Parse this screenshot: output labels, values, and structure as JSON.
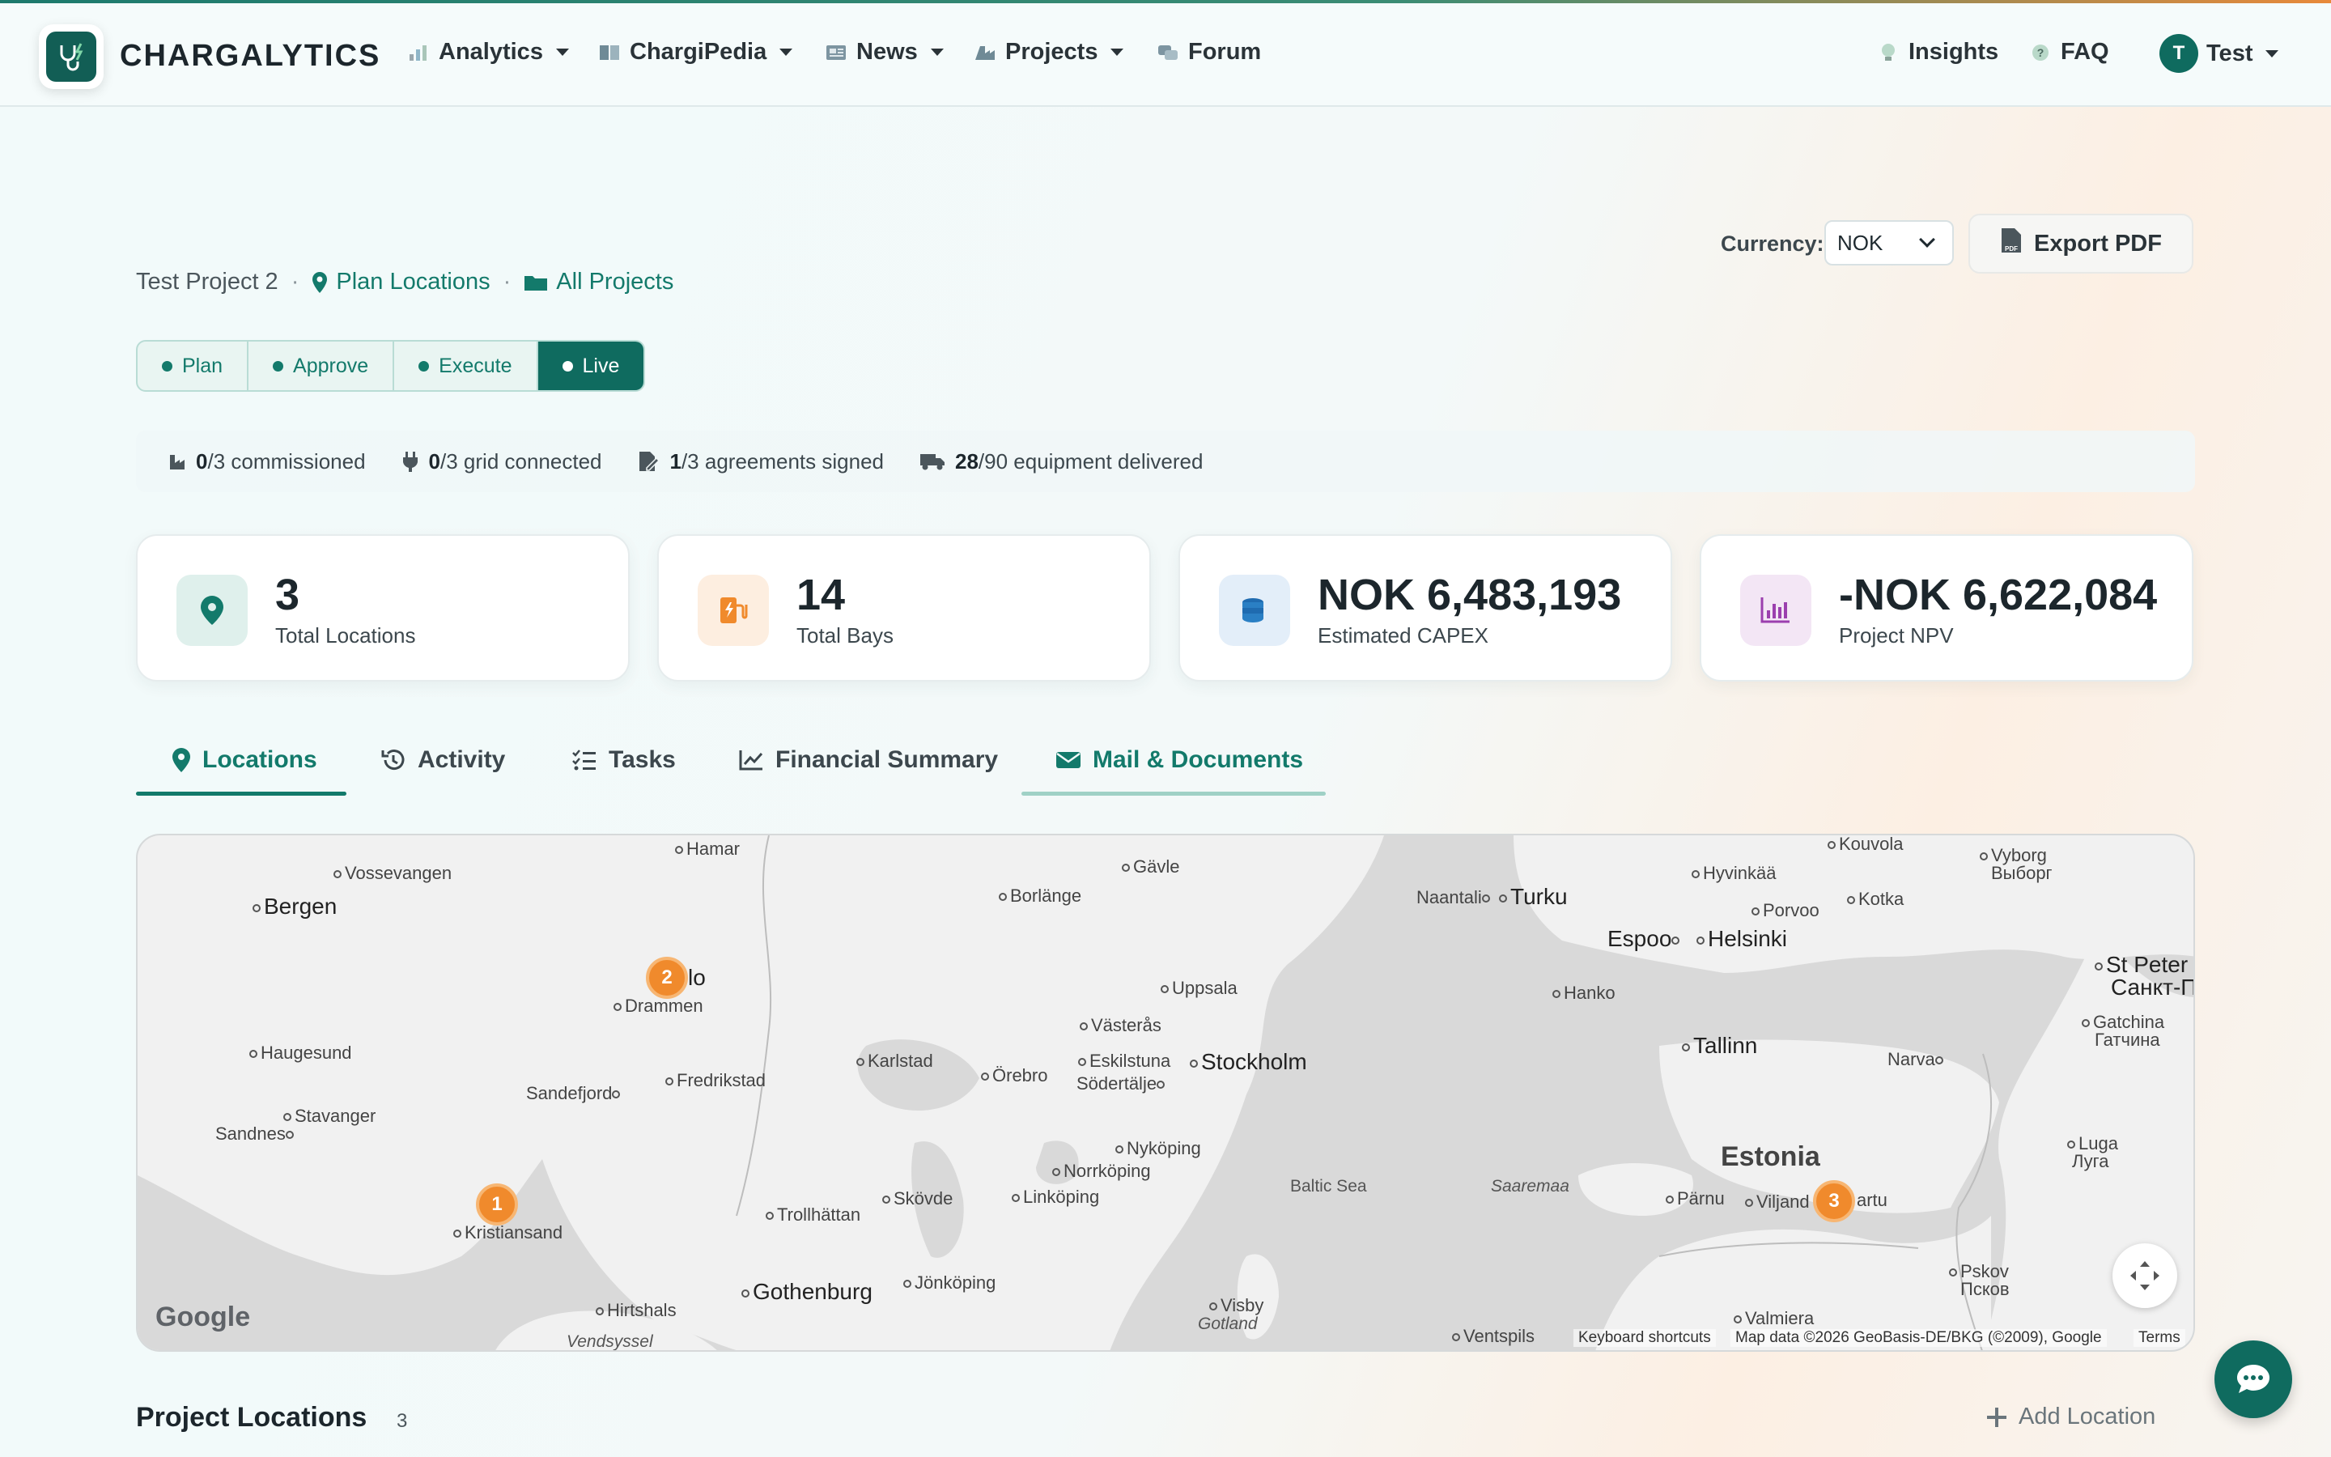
{
  "nav": {
    "brand": "CHARGALYTICS",
    "items": [
      {
        "label": "Analytics",
        "icon": "analytics-icon"
      },
      {
        "label": "ChargiPedia",
        "icon": "book-icon"
      },
      {
        "label": "News",
        "icon": "newspaper-icon"
      },
      {
        "label": "Projects",
        "icon": "projects-icon"
      },
      {
        "label": "Forum",
        "icon": "forum-icon"
      }
    ],
    "insights": "Insights",
    "faq": "FAQ",
    "user_initial": "T",
    "user_name": "Test"
  },
  "header": {
    "currency_label": "Currency:",
    "currency_value": "NOK",
    "export_label": "Export PDF"
  },
  "breadcrumb": {
    "project": "Test Project 2",
    "plan_locations": "Plan Locations",
    "all_projects": "All Projects"
  },
  "stages": [
    {
      "label": "Plan",
      "active": false
    },
    {
      "label": "Approve",
      "active": false
    },
    {
      "label": "Execute",
      "active": false
    },
    {
      "label": "Live",
      "active": true
    }
  ],
  "progress": [
    {
      "done": "0",
      "rest": "/3 commissioned",
      "icon": "factory-icon"
    },
    {
      "done": "0",
      "rest": "/3 grid connected",
      "icon": "plug-icon"
    },
    {
      "done": "1",
      "rest": "/3 agreements signed",
      "icon": "signature-icon"
    },
    {
      "done": "28",
      "rest": "/90 equipment delivered",
      "icon": "truck-icon"
    }
  ],
  "stats": [
    {
      "value": "3",
      "label": "Total Locations",
      "icon": "location-pin-icon"
    },
    {
      "value": "14",
      "label": "Total Bays",
      "icon": "charging-station-icon"
    },
    {
      "value": "NOK 6,483,193",
      "label": "Estimated CAPEX",
      "icon": "coins-icon"
    },
    {
      "value": "-NOK 6,622,084",
      "label": "Project NPV",
      "icon": "bar-chart-icon"
    }
  ],
  "tabs": [
    {
      "label": "Locations",
      "icon": "location-pin-icon"
    },
    {
      "label": "Activity",
      "icon": "history-icon"
    },
    {
      "label": "Tasks",
      "icon": "checklist-icon"
    },
    {
      "label": "Financial Summary",
      "icon": "line-chart-icon"
    },
    {
      "label": "Mail & Documents",
      "icon": "envelope-icon"
    }
  ],
  "map": {
    "labels": {
      "bergen": "Bergen",
      "vossevangen": "Vossevangen",
      "hamar": "Hamar",
      "gavle": "Gävle",
      "borlange": "Borlänge",
      "oslo": "lo",
      "drammen": "Drammen",
      "haugesund": "Haugesund",
      "stavanger": "Stavanger",
      "sandnes": "Sandnes",
      "sandefjord": "Sandefjord",
      "fredrikstad": "Fredrikstad",
      "karlstad": "Karlstad",
      "orebro": "Örebro",
      "vasteras": "Västerås",
      "uppsala": "Uppsala",
      "eskilstuna": "Eskilstuna",
      "sodertalje": "Södertälje",
      "stockholm": "Stockholm",
      "nykoping": "Nyköping",
      "norrkoping": "Norrköping",
      "linkoping": "Linköping",
      "skovde": "Skövde",
      "trollhattan": "Trollhättan",
      "jonkoping": "Jönköping",
      "gothenburg": "Gothenburg",
      "kristiansand": "Kristiansand",
      "hirtshals": "Hirtshals",
      "vendsyssel": "Vendsyssel",
      "visby": "Visby",
      "gotland": "Gotland",
      "baltic": "Baltic Sea",
      "naantali": "Naantali",
      "turku": "Turku",
      "hyvinkaa": "Hyvinkää",
      "kouvola": "Kouvola",
      "porvoo": "Porvoo",
      "kotka": "Kotka",
      "vyborg": "Vyborg",
      "vyborg_ru": "Выборг",
      "espoo": "Espoo",
      "helsinki": "Helsinki",
      "hanko": "Hanko",
      "tallinn": "Tallinn",
      "narva": "Narva",
      "stpeter": "St Peter",
      "stpeter_ru": "Санкт-П",
      "gatchina": "Gatchina",
      "gatchina_ru": "Гатчина",
      "estonia": "Estonia",
      "saaremaa": "Saaremaa",
      "parnu": "Pärnu",
      "viljandi": "Viljand",
      "tartu": "artu",
      "luga": "Luga",
      "luga_ru": "Луга",
      "pskov": "Pskov",
      "pskov_ru": "Псков",
      "valmiera": "Valmiera",
      "ventspils": "Ventspils"
    },
    "markers": [
      "2",
      "1",
      "3"
    ],
    "google": "Google",
    "shortcuts": "Keyboard shortcuts",
    "mapdata": "Map data ©2026 GeoBasis-DE/BKG (©2009), Google",
    "terms": "Terms"
  },
  "bottom": {
    "section_title": "Project Locations",
    "section_count": "3",
    "add_location": "Add Location"
  },
  "colors": {
    "primary": "#0f6b5f",
    "accent": "#137a6b",
    "marker": "#f08a2c"
  }
}
